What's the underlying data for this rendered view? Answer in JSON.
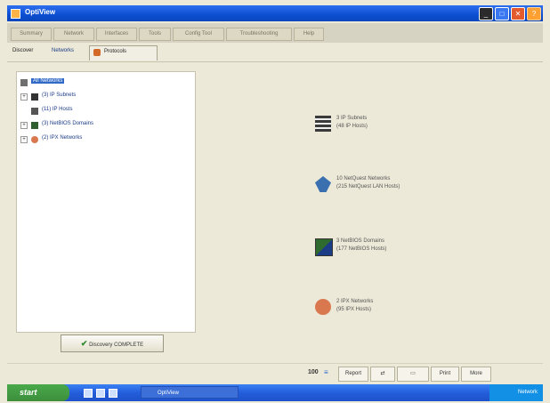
{
  "window": {
    "title": "OptiView"
  },
  "top_tabs": [
    "Summary",
    "Network",
    "Interfaces",
    "Tools",
    "Config Tool",
    "Troubleshooting",
    "Help"
  ],
  "sub_nav": {
    "left_label": "Discover",
    "tab_networks": "Networks",
    "tab_protocols": "Protocols"
  },
  "tree": {
    "root": "All Networks",
    "items": [
      {
        "expander": "+",
        "label": "(3) IP Subnets",
        "icon": "subnet-icon"
      },
      {
        "expander": "",
        "label": "(11) IP Hosts",
        "icon": "host-icon"
      },
      {
        "expander": "+",
        "label": "(3) NetBIOS Domains",
        "icon": "netbios-icon"
      },
      {
        "expander": "+",
        "label": "(2) IPX Networks",
        "icon": "ipx-icon"
      }
    ]
  },
  "summary_button": "Discovery COMPLETE",
  "summary": [
    {
      "icon": "ip-subnet-icon",
      "line1": "3 IP Subnets",
      "line2": "(48 IP Hosts)",
      "color": "#4a4a4a"
    },
    {
      "icon": "nextquest-icon",
      "line1": "10 NetQuest Networks",
      "line2": "(215 NetQuest LAN Hosts)",
      "color": "#3a6fb0"
    },
    {
      "icon": "netbios-domain-icon",
      "line1": "3 NetBIOS Domains",
      "line2": "(177 NetBIOS Hosts)",
      "color": "#2f6b2f"
    },
    {
      "icon": "ipx-network-icon",
      "line1": "2 IPX Networks",
      "line2": "(95 IPX Hosts)",
      "color": "#d9784f"
    }
  ],
  "toolbar": {
    "count": "100",
    "report": "Report",
    "print": "Print",
    "more": "More"
  },
  "taskbar": {
    "start": "start",
    "task": "OptiView",
    "tray": "Network"
  }
}
